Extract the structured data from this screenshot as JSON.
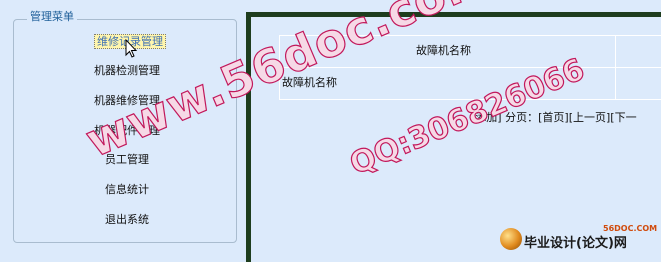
{
  "menu": {
    "title": "管理菜单",
    "items": [
      {
        "label": "维修记录管理",
        "selected": true
      },
      {
        "label": "机器检测管理"
      },
      {
        "label": "机器维修管理"
      },
      {
        "label": "机器配件管理"
      },
      {
        "label": "员工管理"
      },
      {
        "label": "信息统计"
      },
      {
        "label": "退出系统"
      }
    ]
  },
  "table": {
    "header": "故障机名称",
    "row_label": "故障机名称"
  },
  "pager": {
    "add": "[添加]",
    "paging_label": "分页：",
    "first": "[首页]",
    "prev": "[上一页]",
    "next": "[下一"
  },
  "watermarks": {
    "site": "www.56doc.com",
    "qq": "QQ:306826066",
    "logo_site": "56DOC.COM",
    "logo_text": "毕业设计(论文)网"
  },
  "colors": {
    "background": "#dceafb",
    "panel_border": "#1e3d1e",
    "selected_bg": "#fff6ad",
    "watermark": "#c2185b"
  }
}
